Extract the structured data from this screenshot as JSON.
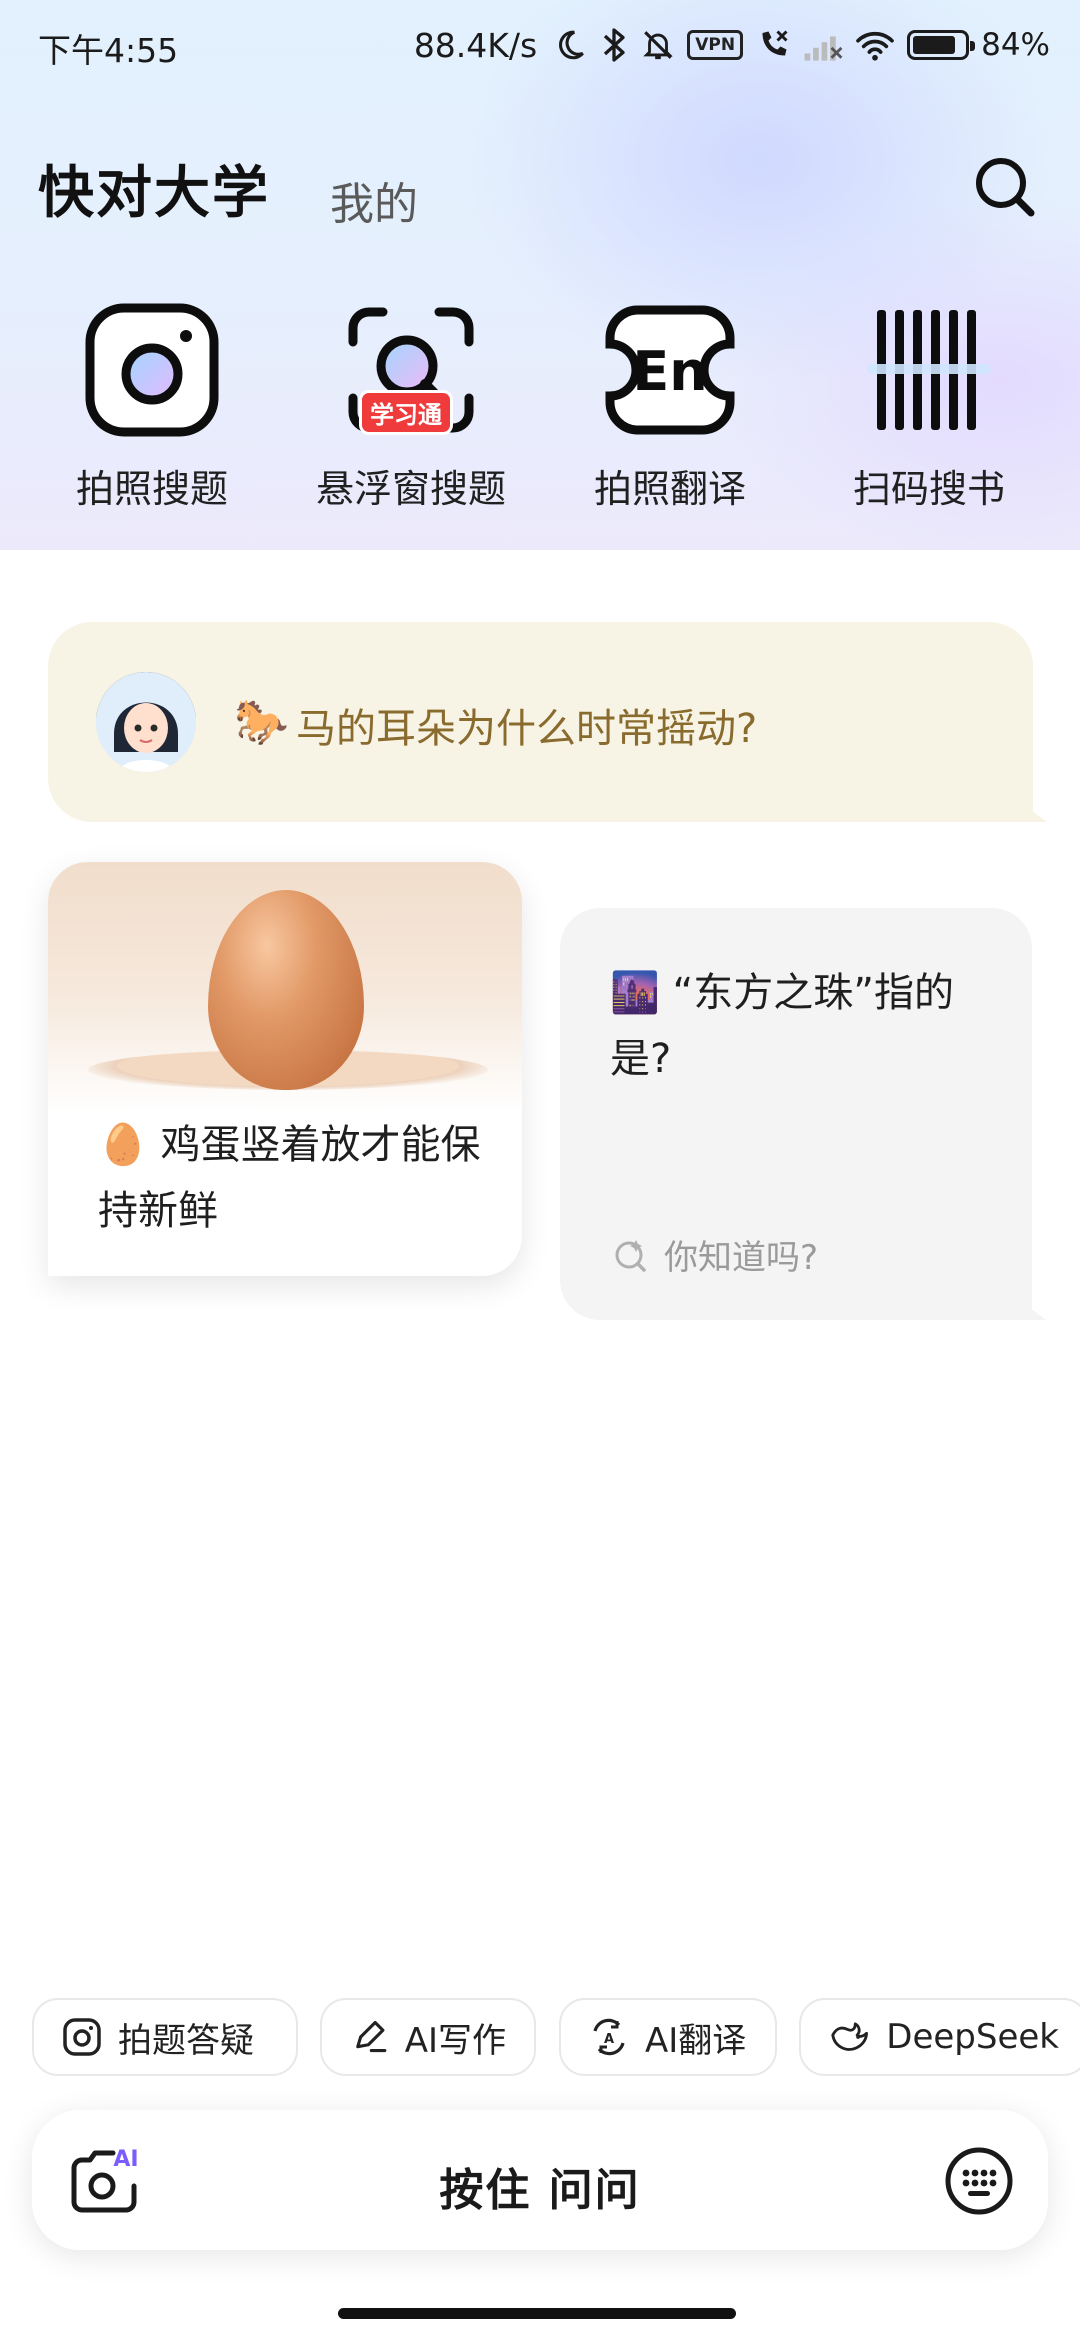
{
  "status_bar": {
    "time": "下午4:55",
    "speed": "88.4K/s",
    "vpn": "VPN",
    "battery": "84%",
    "battery_level": 0.84
  },
  "nav": {
    "title": "快对大学",
    "tab_mine": "我的"
  },
  "tools": [
    {
      "label": "拍照搜题",
      "icon": "camera-icon"
    },
    {
      "label": "悬浮窗搜题",
      "icon": "float-search-icon",
      "badge": "学习通"
    },
    {
      "label": "拍照翻译",
      "icon": "translate-en-icon"
    },
    {
      "label": "扫码搜书",
      "icon": "barcode-icon"
    }
  ],
  "cards": {
    "horse": {
      "emoji": "🐎",
      "text": "马的耳朵为什么时常摇动?"
    },
    "egg": {
      "emoji": "🥚",
      "text": "鸡蛋竖着放才能保持新鲜"
    },
    "pearl": {
      "emoji": "🌆",
      "text": "“东方之珠”指的是?",
      "tip": "你知道吗?"
    }
  },
  "chips": [
    {
      "label": "拍题答疑",
      "icon": "camera-icon"
    },
    {
      "label": "AI写作",
      "icon": "pen-icon"
    },
    {
      "label": "AI翻译",
      "icon": "translate-icon"
    },
    {
      "label": "DeepSeek",
      "icon": "whale-icon"
    }
  ],
  "ask_bar": {
    "label": "按住 问问",
    "camera_badge": "AI"
  },
  "colors": {
    "accent_gold": "#8a6b2e",
    "badge_red": "#ef3b3b",
    "ai_purple": "#7b5cff"
  }
}
